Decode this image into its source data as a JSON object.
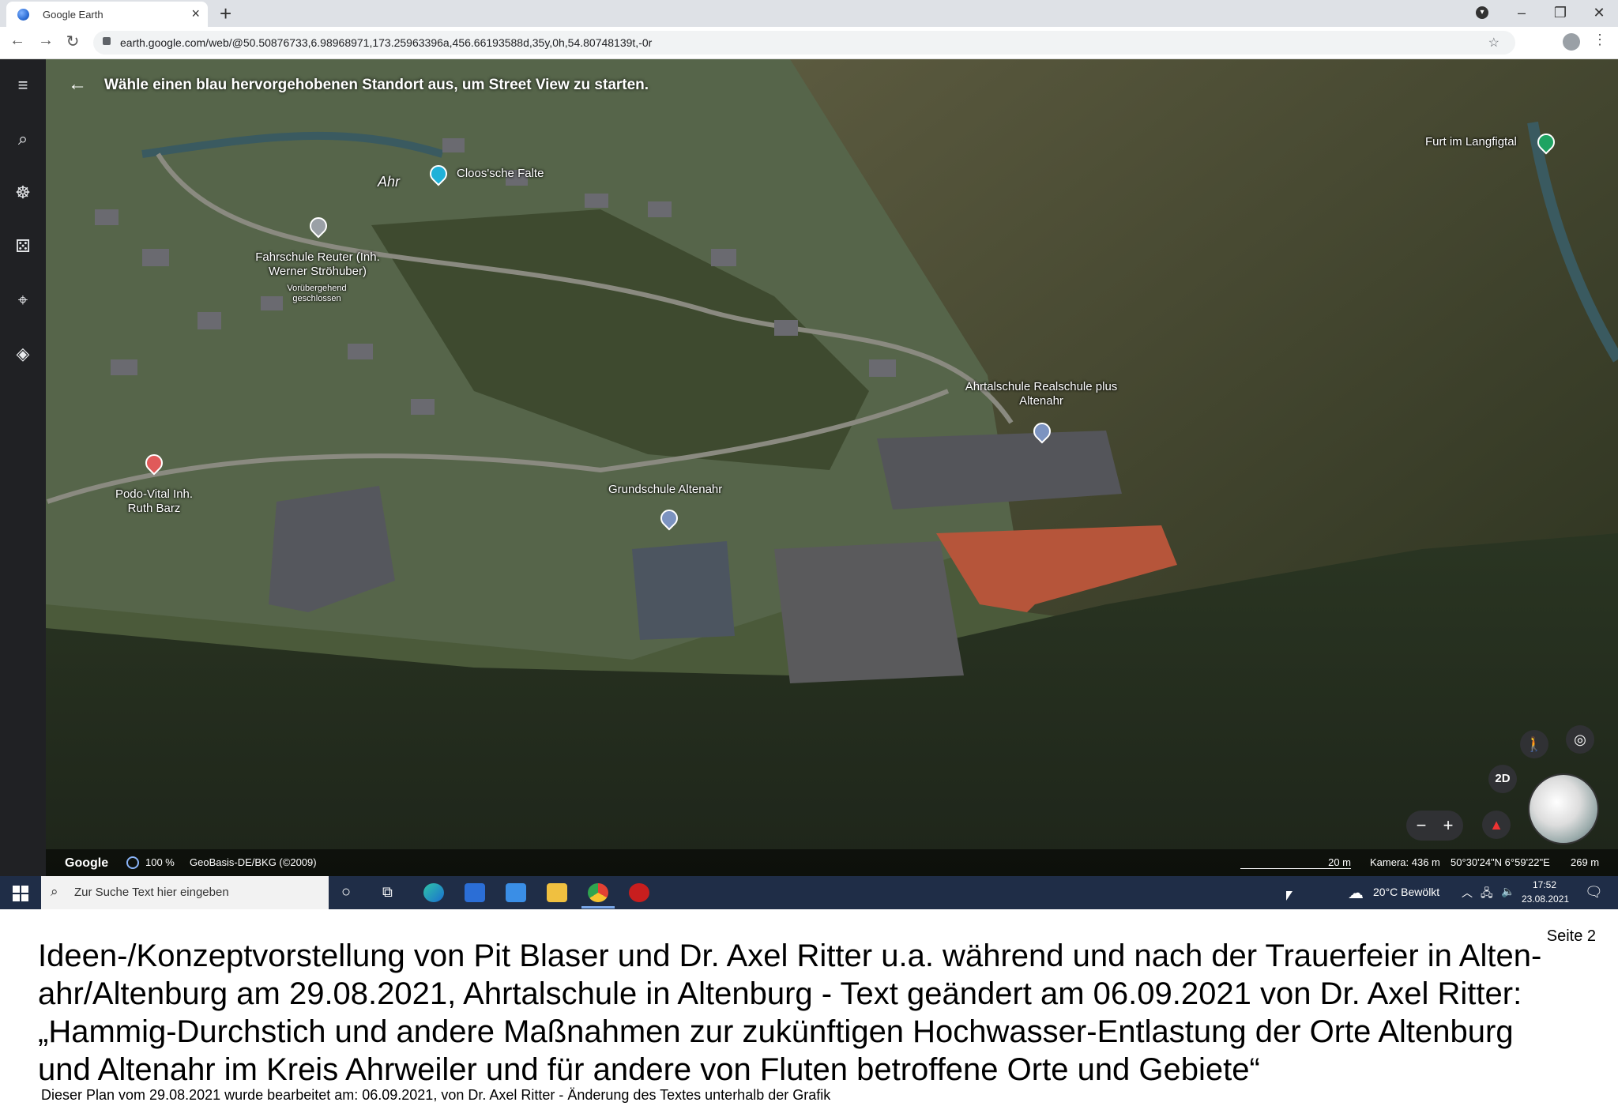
{
  "browser": {
    "tab_title": "Google Earth",
    "tab_close": "×",
    "new_tab": "+",
    "window_controls": {
      "minimize": "–",
      "restore": "❐",
      "close": "✕"
    },
    "url": "earth.google.com/web/@50.50876733,6.98968971,173.25963396a,456.66193588d,35y,0h,54.80748139t,-0r",
    "nav": {
      "back": "←",
      "forward": "→",
      "reload": "↻"
    }
  },
  "earth": {
    "banner": "Wähle einen blau hervorgehobenen Standort aus, um Street View zu starten.",
    "places": [
      {
        "name": "Cloos'sche Falte"
      },
      {
        "name": "Ahr"
      },
      {
        "name": "Fahrschule Reuter (Inh. Werner Ströhuber)"
      },
      {
        "name": "Vorübergehend geschlossen"
      },
      {
        "name": "Podo-Vital Inh. Ruth Barz"
      },
      {
        "name": "Grundschule Altenahr"
      },
      {
        "name": "Ahrtalschule Realschule plus Altenahr"
      },
      {
        "name": "Furt im Langfigtal"
      }
    ],
    "sidebar_icons": [
      "menu-icon",
      "search-icon",
      "voyager-icon",
      "feeling-lucky-icon",
      "projects-icon",
      "layers-icon"
    ],
    "attribution": {
      "logo": "Google",
      "loading": "100 %",
      "source": "GeoBasis-DE/BKG (©2009)",
      "scale": "20 m",
      "camera": "Kamera: 436 m",
      "coords": "50°30'24\"N 6°59'22\"E",
      "altitude": "269 m"
    },
    "controls": {
      "view_2d": "2D",
      "zoom_out": "−",
      "zoom_in": "+"
    }
  },
  "taskbar": {
    "search_placeholder": "Zur Suche Text hier eingeben",
    "weather": "20°C  Bewölkt",
    "time": "17:52",
    "date": "23.08.2021"
  },
  "document": {
    "page": "Seite 2",
    "caption_lines": [
      "Ideen-/Konzeptvorstellung von Pit Blaser und Dr. Axel Ritter u.a. während und nach der Trauerfeier in Alten-",
      "ahr/Altenburg am 29.08.2021, Ahrtalschule in Altenburg - Text geändert am 06.09.2021 von Dr. Axel Ritter:",
      "„Hammig-Durchstich und andere Maßnahmen zur zukünftigen Hochwasser-Entlastung der Orte Altenburg",
      "und Altenahr im Kreis Ahrweiler und für andere von Fluten betroffene Orte und Gebiete“"
    ],
    "footnote": "Dieser Plan vom 29.08.2021 wurde bearbeitet am: 06.09.2021, von Dr. Axel Ritter - Änderung des Textes unterhalb der Grafik"
  }
}
